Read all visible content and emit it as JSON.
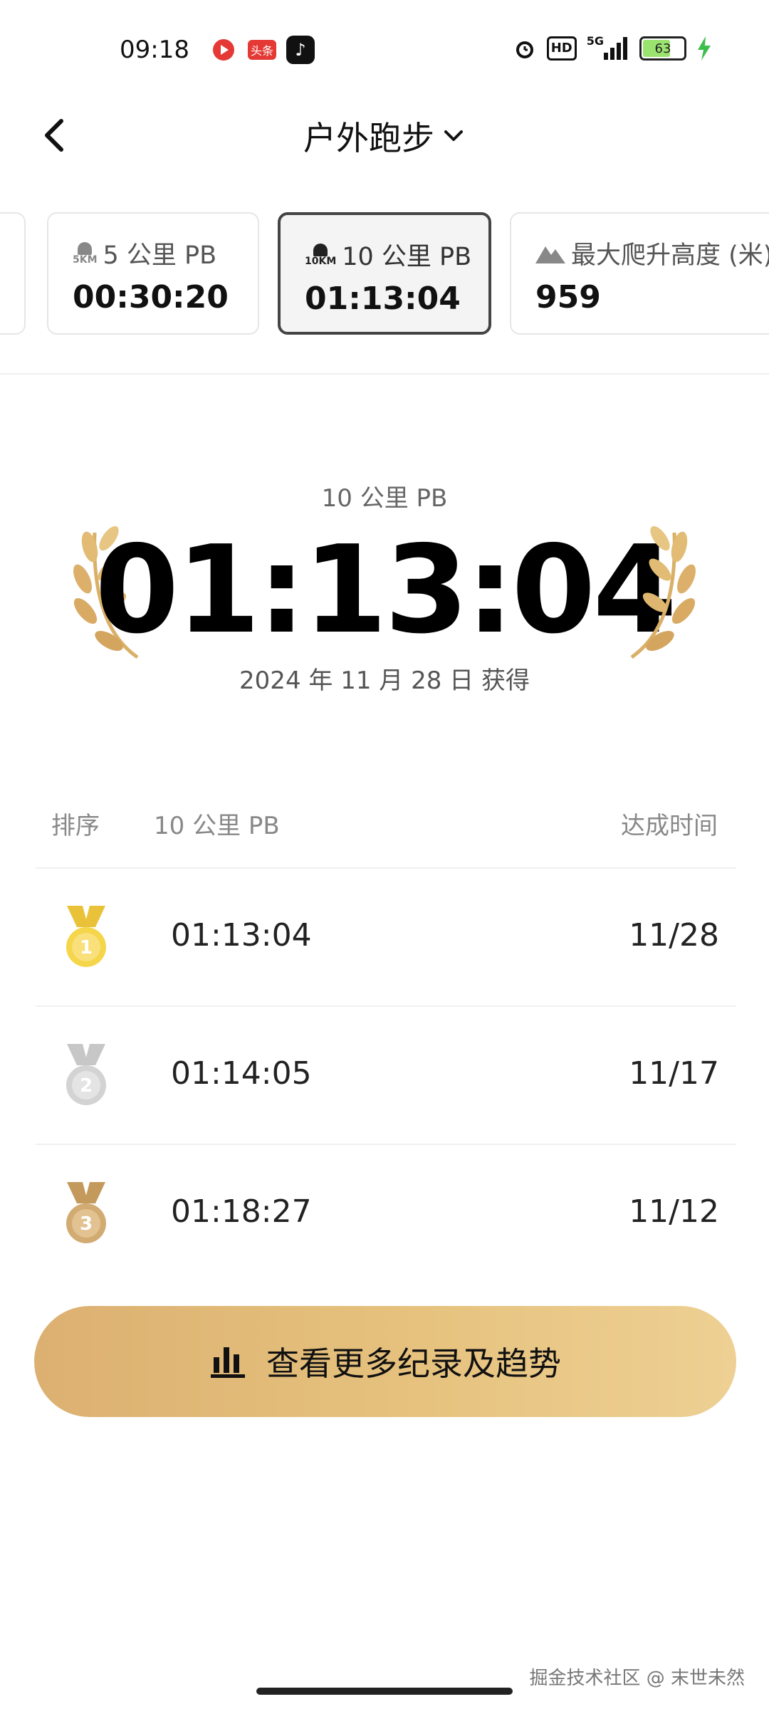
{
  "status": {
    "time": "09:18",
    "toutiao_label": "头条",
    "network": "5G",
    "hd_label": "HD",
    "battery": "63",
    "battery_level": 0.63
  },
  "nav": {
    "title": "户外跑步"
  },
  "cards": [
    {
      "label": "5 公里 PB",
      "icon_text": "5KM",
      "value": "00:30:20"
    },
    {
      "label": "10 公里 PB",
      "icon_text": "10KM",
      "value": "01:13:04"
    },
    {
      "label": "最大爬升高度 (米)",
      "value": "959"
    }
  ],
  "hero": {
    "subtitle": "10 公里 PB",
    "time": "01:13:04",
    "date": "2024 年 11 月 28 日 获得"
  },
  "ranking": {
    "col1": "排序",
    "col2": "10 公里 PB",
    "col3": "达成时间",
    "rows": [
      {
        "rank": "1",
        "time": "01:13:04",
        "date": "11/28"
      },
      {
        "rank": "2",
        "time": "01:14:05",
        "date": "11/17"
      },
      {
        "rank": "3",
        "time": "01:18:27",
        "date": "11/12"
      }
    ]
  },
  "cta": {
    "label": "查看更多纪录及趋势"
  },
  "watermark": "掘金技术社区 @ 末世未然",
  "colors": {
    "gold": "#dcb071",
    "silver": "#c9c9c9",
    "bronze": "#c8a06a"
  }
}
